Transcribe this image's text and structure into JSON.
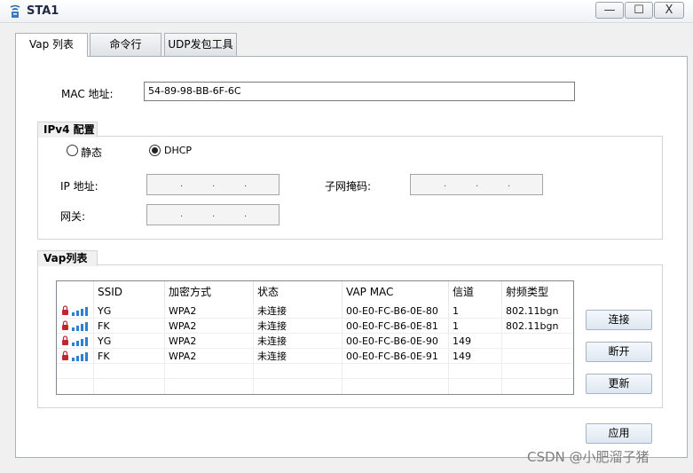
{
  "window": {
    "title": "STA1",
    "minimize": "—",
    "maximize": "☐",
    "close": "X"
  },
  "tabs": [
    {
      "label": "Vap 列表",
      "active": true
    },
    {
      "label": "命令行",
      "active": false
    },
    {
      "label": "UDP发包工具",
      "active": false
    }
  ],
  "mac": {
    "label": "MAC 地址:",
    "value": "54-89-98-BB-6F-6C"
  },
  "ipv4": {
    "group_title": "IPv4 配置",
    "static_label": "静态",
    "dhcp_label": "DHCP",
    "selected": "DHCP",
    "ip_label": "IP 地址:",
    "mask_label": "子网掩码:",
    "gateway_label": "网关:",
    "dot": "."
  },
  "vap": {
    "group_title": "Vap列表",
    "columns": [
      "",
      "SSID",
      "加密方式",
      "状态",
      "VAP MAC",
      "信道",
      "射频类型"
    ],
    "rows": [
      {
        "ssid": "YG",
        "enc": "WPA2",
        "status": "未连接",
        "mac": "00-E0-FC-B6-0E-80",
        "channel": "1",
        "radio": "802.11bgn"
      },
      {
        "ssid": "FK",
        "enc": "WPA2",
        "status": "未连接",
        "mac": "00-E0-FC-B6-0E-81",
        "channel": "1",
        "radio": "802.11bgn"
      },
      {
        "ssid": "YG",
        "enc": "WPA2",
        "status": "未连接",
        "mac": "00-E0-FC-B6-0E-90",
        "channel": "149",
        "radio": ""
      },
      {
        "ssid": "FK",
        "enc": "WPA2",
        "status": "未连接",
        "mac": "00-E0-FC-B6-0E-91",
        "channel": "149",
        "radio": ""
      }
    ],
    "connect_label": "连接",
    "disconnect_label": "断开",
    "refresh_label": "更新"
  },
  "apply_label": "应用",
  "watermark": "CSDN @小肥溜子猪",
  "colors": {
    "signal": "#2b7fd4",
    "lock": "#c0272d"
  }
}
